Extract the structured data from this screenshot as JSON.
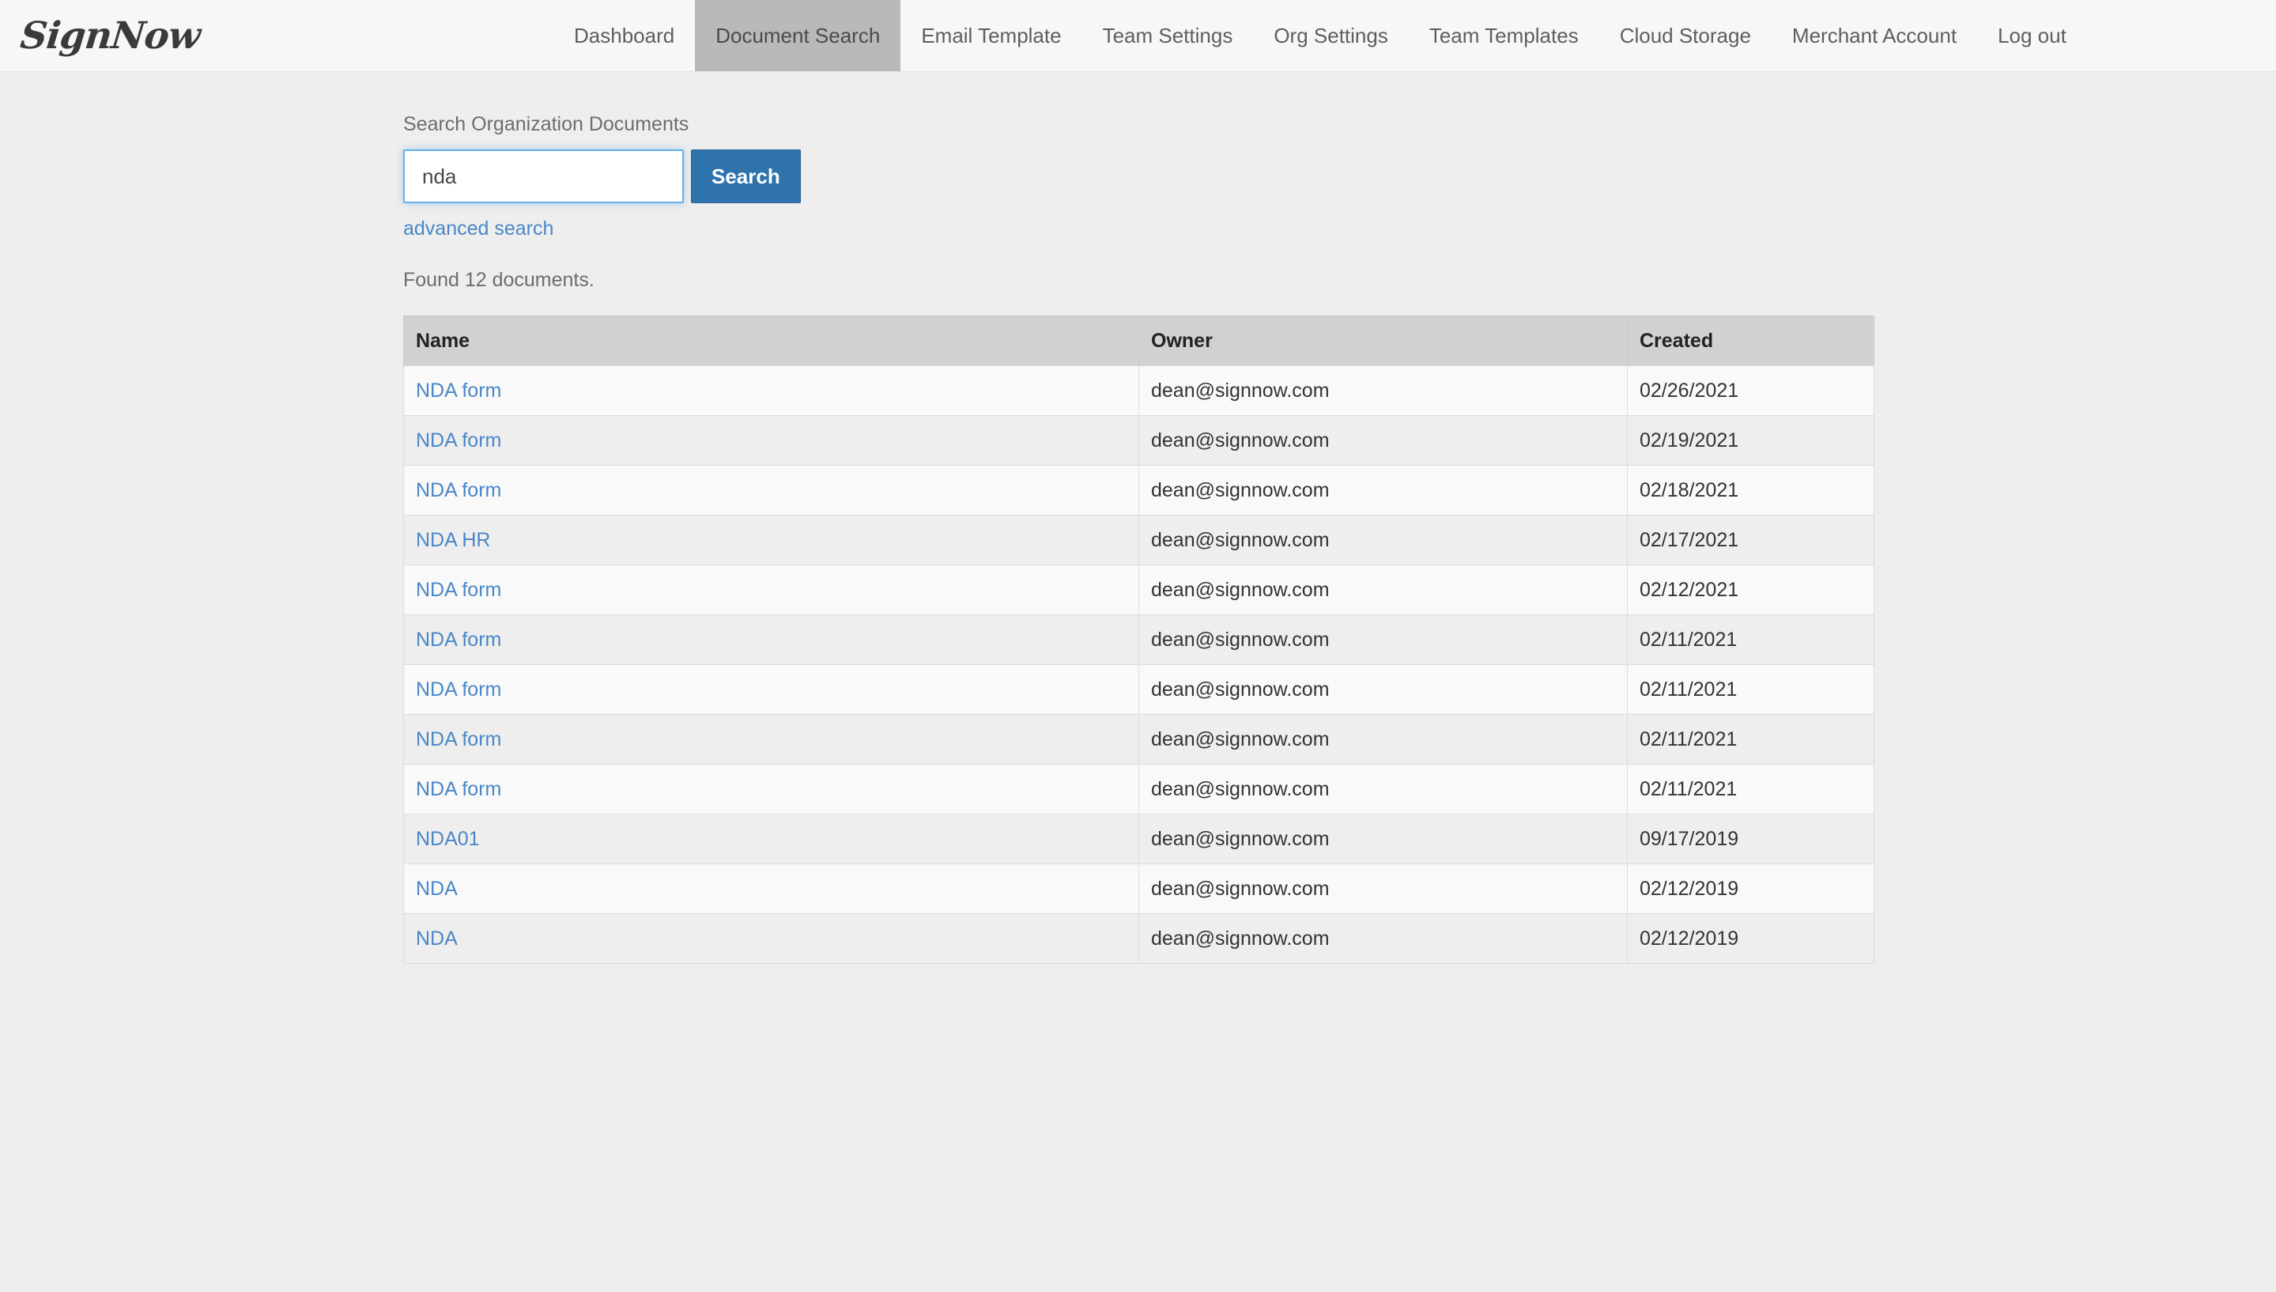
{
  "brand": {
    "name": "SignNow"
  },
  "nav": {
    "items": [
      {
        "label": "Dashboard",
        "active": false
      },
      {
        "label": "Document Search",
        "active": true
      },
      {
        "label": "Email Template",
        "active": false
      },
      {
        "label": "Team Settings",
        "active": false
      },
      {
        "label": "Org Settings",
        "active": false
      },
      {
        "label": "Team Templates",
        "active": false
      },
      {
        "label": "Cloud Storage",
        "active": false
      },
      {
        "label": "Merchant Account",
        "active": false
      },
      {
        "label": "Log out",
        "active": false
      }
    ]
  },
  "search": {
    "label": "Search Organization Documents",
    "value": "nda",
    "placeholder": "",
    "button_label": "Search",
    "advanced_link": "advanced search",
    "button_color": "#2f73ac",
    "focus_color": "#66afe9"
  },
  "results": {
    "status": "Found 12 documents.",
    "columns": [
      "Name",
      "Owner",
      "Created"
    ],
    "rows": [
      {
        "name": "NDA form",
        "owner": "dean@signnow.com",
        "created": "02/26/2021"
      },
      {
        "name": "NDA form",
        "owner": "dean@signnow.com",
        "created": "02/19/2021"
      },
      {
        "name": "NDA form",
        "owner": "dean@signnow.com",
        "created": "02/18/2021"
      },
      {
        "name": "NDA HR",
        "owner": "dean@signnow.com",
        "created": "02/17/2021"
      },
      {
        "name": "NDA form",
        "owner": "dean@signnow.com",
        "created": "02/12/2021"
      },
      {
        "name": "NDA form",
        "owner": "dean@signnow.com",
        "created": "02/11/2021"
      },
      {
        "name": "NDA form",
        "owner": "dean@signnow.com",
        "created": "02/11/2021"
      },
      {
        "name": "NDA form",
        "owner": "dean@signnow.com",
        "created": "02/11/2021"
      },
      {
        "name": "NDA form",
        "owner": "dean@signnow.com",
        "created": "02/11/2021"
      },
      {
        "name": "NDA01",
        "owner": "dean@signnow.com",
        "created": "09/17/2019"
      },
      {
        "name": "NDA",
        "owner": "dean@signnow.com",
        "created": "02/12/2019"
      },
      {
        "name": "NDA",
        "owner": "dean@signnow.com",
        "created": "02/12/2019"
      }
    ],
    "link_color": "#4a87c7",
    "header_bg": "#d2d1d0"
  }
}
